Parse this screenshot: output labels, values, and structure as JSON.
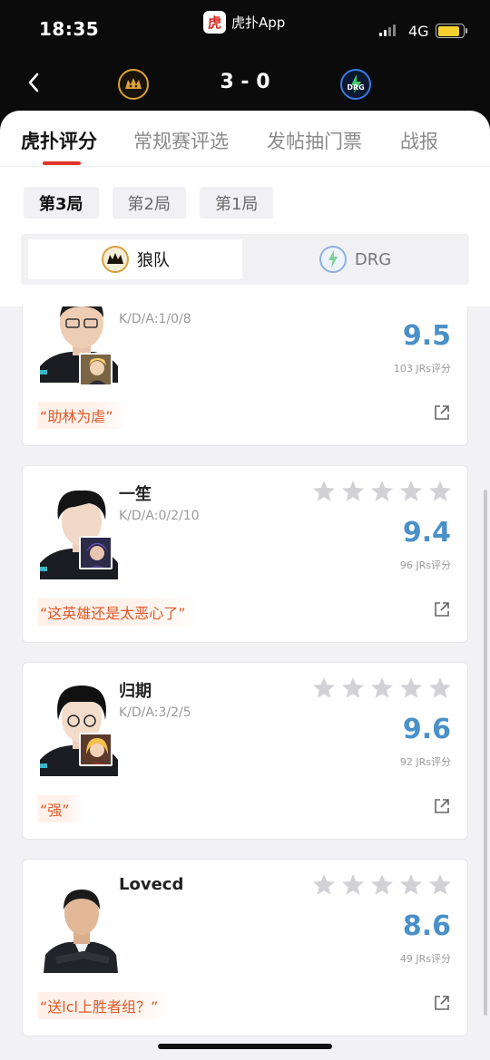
{
  "status_bar": {
    "time": "18:35",
    "app_name": "虎扑App",
    "app_logo_char": "虎",
    "network": "4G"
  },
  "match": {
    "score": "3 - 0",
    "home_logo_text": "WOLVES",
    "away_logo_text": "DRG"
  },
  "tabs": [
    {
      "label": "虎扑评分",
      "active": true
    },
    {
      "label": "常规赛评选",
      "active": false
    },
    {
      "label": "发帖抽门票",
      "active": false
    },
    {
      "label": "战报",
      "active": false
    }
  ],
  "games": [
    {
      "label": "第3局",
      "active": true
    },
    {
      "label": "第2局",
      "active": false
    },
    {
      "label": "第1局",
      "active": false
    }
  ],
  "teams": [
    {
      "label": "狼队",
      "active": true
    },
    {
      "label": "DRG",
      "active": false
    }
  ],
  "players": [
    {
      "name": "",
      "kda": "K/D/A:1/0/8",
      "rating": "9.5",
      "votes": "103 JRs评分",
      "comment": "“助林为虐”",
      "stars": 5
    },
    {
      "name": "一笙",
      "kda": "K/D/A:0/2/10",
      "rating": "9.4",
      "votes": "96 JRs评分",
      "comment": "“这英雄还是太恶心了”",
      "stars": 5
    },
    {
      "name": "归期",
      "kda": "K/D/A:3/2/5",
      "rating": "9.6",
      "votes": "92 JRs评分",
      "comment": "“强”",
      "stars": 5
    },
    {
      "name": "Lovecd",
      "kda": "",
      "rating": "8.6",
      "votes": "49 JRs评分",
      "comment": "“送lcl上胜者组？”",
      "stars": 5
    }
  ],
  "colors": {
    "accent": "#e0332b",
    "rating": "#4a90c9",
    "comment": "#e05a2a",
    "star": "#d2d2d6"
  }
}
